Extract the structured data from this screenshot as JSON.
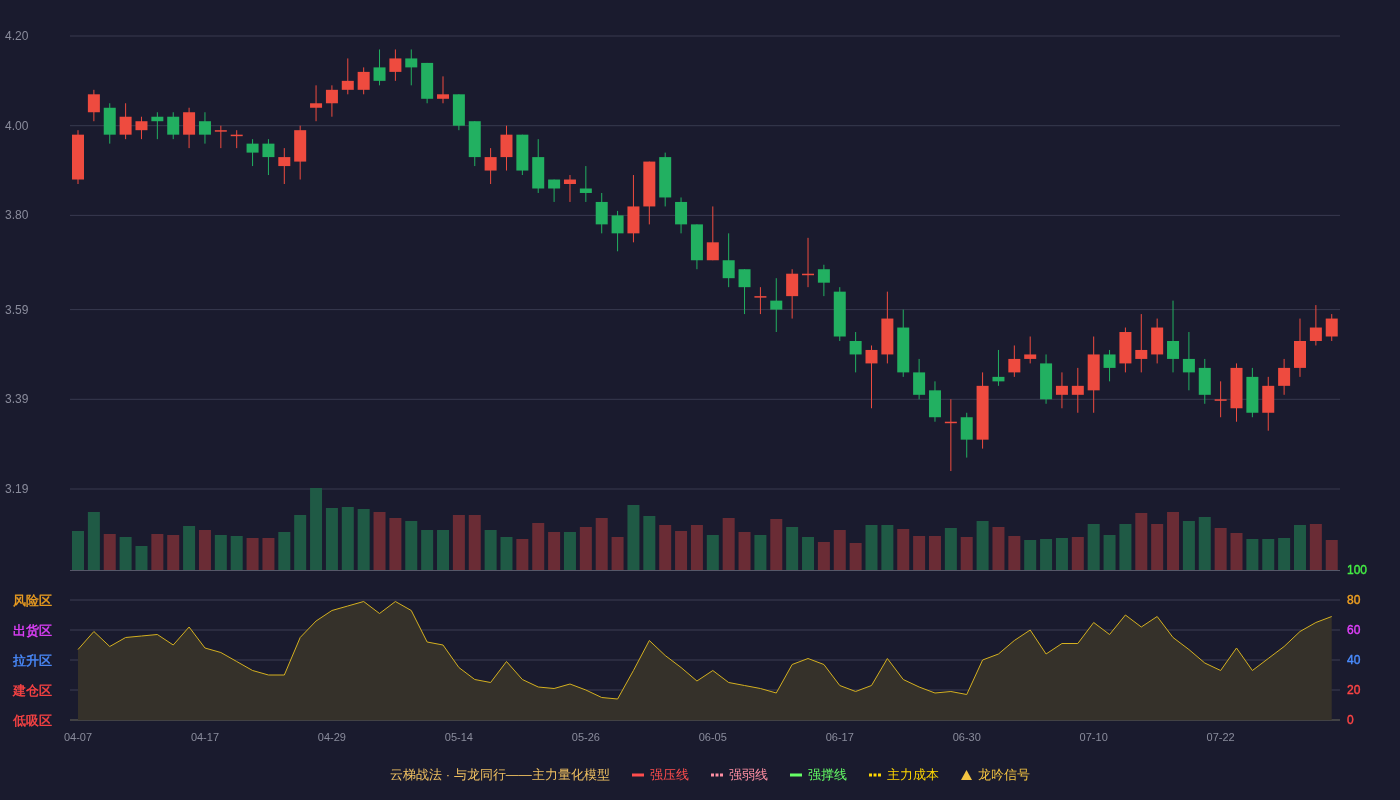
{
  "price_chart": {
    "chart_data": {
      "type": "candlestick",
      "grid": true,
      "ylim": [
        3.19,
        4.2
      ],
      "yticks": [
        {
          "value": 4.2,
          "label": "4.20"
        },
        {
          "value": 4.0,
          "label": "4.00"
        },
        {
          "value": 3.8,
          "label": "3.80"
        },
        {
          "value": 3.59,
          "label": "3.59"
        },
        {
          "value": 3.39,
          "label": "3.39"
        },
        {
          "value": 3.19,
          "label": "3.19"
        }
      ],
      "ohlc": [
        [
          3.88,
          3.99,
          3.87,
          3.98
        ],
        [
          4.03,
          4.08,
          4.01,
          4.07
        ],
        [
          4.04,
          4.05,
          3.96,
          3.98
        ],
        [
          3.98,
          4.05,
          3.97,
          4.02
        ],
        [
          3.99,
          4.02,
          3.97,
          4.01
        ],
        [
          4.02,
          4.03,
          3.97,
          4.01
        ],
        [
          4.02,
          4.03,
          3.97,
          3.98
        ],
        [
          3.98,
          4.04,
          3.95,
          4.03
        ],
        [
          4.01,
          4.03,
          3.96,
          3.98
        ],
        [
          3.99,
          4.0,
          3.95,
          3.99
        ],
        [
          3.98,
          3.99,
          3.95,
          3.98
        ],
        [
          3.96,
          3.97,
          3.91,
          3.94
        ],
        [
          3.96,
          3.97,
          3.89,
          3.93
        ],
        [
          3.91,
          3.95,
          3.87,
          3.93
        ],
        [
          3.92,
          4.0,
          3.88,
          3.99
        ],
        [
          4.04,
          4.09,
          4.01,
          4.05
        ],
        [
          4.05,
          4.09,
          4.02,
          4.08
        ],
        [
          4.08,
          4.15,
          4.07,
          4.1
        ],
        [
          4.08,
          4.13,
          4.07,
          4.12
        ],
        [
          4.13,
          4.17,
          4.09,
          4.1
        ],
        [
          4.12,
          4.17,
          4.1,
          4.15
        ],
        [
          4.15,
          4.17,
          4.09,
          4.13
        ],
        [
          4.14,
          4.14,
          4.05,
          4.06
        ],
        [
          4.06,
          4.11,
          4.05,
          4.07
        ],
        [
          4.07,
          4.07,
          3.99,
          4.0
        ],
        [
          4.01,
          4.01,
          3.91,
          3.93
        ],
        [
          3.9,
          3.95,
          3.87,
          3.93
        ],
        [
          3.93,
          4.0,
          3.9,
          3.98
        ],
        [
          3.98,
          3.98,
          3.89,
          3.9
        ],
        [
          3.93,
          3.97,
          3.85,
          3.86
        ],
        [
          3.88,
          3.88,
          3.83,
          3.86
        ],
        [
          3.87,
          3.89,
          3.83,
          3.88
        ],
        [
          3.86,
          3.91,
          3.83,
          3.85
        ],
        [
          3.83,
          3.85,
          3.76,
          3.78
        ],
        [
          3.8,
          3.81,
          3.72,
          3.76
        ],
        [
          3.76,
          3.89,
          3.74,
          3.82
        ],
        [
          3.82,
          3.92,
          3.78,
          3.92
        ],
        [
          3.93,
          3.94,
          3.82,
          3.84
        ],
        [
          3.83,
          3.84,
          3.76,
          3.78
        ],
        [
          3.78,
          3.78,
          3.68,
          3.7
        ],
        [
          3.7,
          3.82,
          3.7,
          3.74
        ],
        [
          3.7,
          3.76,
          3.64,
          3.66
        ],
        [
          3.68,
          3.68,
          3.58,
          3.64
        ],
        [
          3.62,
          3.64,
          3.58,
          3.62
        ],
        [
          3.61,
          3.66,
          3.54,
          3.59
        ],
        [
          3.62,
          3.68,
          3.57,
          3.67
        ],
        [
          3.67,
          3.75,
          3.64,
          3.67
        ],
        [
          3.68,
          3.69,
          3.62,
          3.65
        ],
        [
          3.63,
          3.64,
          3.52,
          3.53
        ],
        [
          3.52,
          3.54,
          3.45,
          3.49
        ],
        [
          3.47,
          3.51,
          3.37,
          3.5
        ],
        [
          3.49,
          3.63,
          3.47,
          3.57
        ],
        [
          3.55,
          3.59,
          3.44,
          3.45
        ],
        [
          3.45,
          3.48,
          3.39,
          3.4
        ],
        [
          3.41,
          3.43,
          3.34,
          3.35
        ],
        [
          3.34,
          3.39,
          3.23,
          3.34
        ],
        [
          3.35,
          3.36,
          3.26,
          3.3
        ],
        [
          3.3,
          3.45,
          3.28,
          3.42
        ],
        [
          3.44,
          3.5,
          3.42,
          3.43
        ],
        [
          3.45,
          3.51,
          3.44,
          3.48
        ],
        [
          3.48,
          3.53,
          3.47,
          3.49
        ],
        [
          3.47,
          3.49,
          3.38,
          3.39
        ],
        [
          3.4,
          3.45,
          3.37,
          3.42
        ],
        [
          3.4,
          3.46,
          3.36,
          3.42
        ],
        [
          3.41,
          3.53,
          3.36,
          3.49
        ],
        [
          3.49,
          3.5,
          3.43,
          3.46
        ],
        [
          3.47,
          3.55,
          3.45,
          3.54
        ],
        [
          3.48,
          3.58,
          3.45,
          3.5
        ],
        [
          3.49,
          3.57,
          3.47,
          3.55
        ],
        [
          3.52,
          3.61,
          3.45,
          3.48
        ],
        [
          3.48,
          3.54,
          3.41,
          3.45
        ],
        [
          3.46,
          3.48,
          3.38,
          3.4
        ],
        [
          3.39,
          3.43,
          3.35,
          3.39
        ],
        [
          3.37,
          3.47,
          3.34,
          3.46
        ],
        [
          3.44,
          3.46,
          3.35,
          3.36
        ],
        [
          3.36,
          3.44,
          3.32,
          3.42
        ],
        [
          3.42,
          3.48,
          3.4,
          3.46
        ],
        [
          3.46,
          3.57,
          3.44,
          3.52
        ],
        [
          3.52,
          3.6,
          3.51,
          3.55
        ],
        [
          3.53,
          3.58,
          3.52,
          3.57
        ]
      ]
    }
  },
  "indicator_chart": {
    "zones": [
      {
        "label": "风险区",
        "color": "#f0a020"
      },
      {
        "label": "出货区",
        "color": "#e040fb"
      },
      {
        "label": "拉升区",
        "color": "#4a8cff"
      },
      {
        "label": "建仓区",
        "color": "#ff4444"
      },
      {
        "label": "低吸区",
        "color": "#ff4444"
      }
    ],
    "tick_styles": [
      {
        "color": "#ff4444"
      },
      {
        "color": "#ff4444"
      },
      {
        "color": "#4a8cff"
      },
      {
        "color": "#e040fb"
      },
      {
        "color": "#f0a020"
      },
      {
        "color": "#44ee44"
      }
    ],
    "chart_data": {
      "type": "area",
      "grid": true,
      "ylim": [
        0,
        100
      ],
      "yticks": [
        0,
        20,
        40,
        60,
        80,
        100
      ],
      "categories": [
        "04-07",
        null,
        null,
        null,
        null,
        null,
        null,
        null,
        "04-17",
        null,
        null,
        null,
        null,
        null,
        null,
        null,
        "04-29",
        null,
        null,
        null,
        null,
        null,
        null,
        null,
        "05-14",
        null,
        null,
        null,
        null,
        null,
        null,
        null,
        "05-26",
        null,
        null,
        null,
        null,
        null,
        null,
        null,
        "06-05",
        null,
        null,
        null,
        null,
        null,
        null,
        null,
        "06-17",
        null,
        null,
        null,
        null,
        null,
        null,
        null,
        "06-30",
        null,
        null,
        null,
        null,
        null,
        null,
        null,
        "07-10",
        null,
        null,
        null,
        null,
        null,
        null,
        null,
        "07-22",
        null,
        null,
        null,
        null,
        null,
        null,
        null
      ],
      "series": [
        {
          "color": "#d4b020",
          "values": [
            47,
            59,
            49,
            55,
            56,
            57,
            50,
            62,
            48,
            45,
            39,
            33,
            30,
            30,
            55,
            66,
            73,
            76,
            79,
            71,
            79,
            73,
            52,
            50,
            35,
            27,
            25,
            39,
            27,
            22,
            21,
            24,
            20,
            15,
            14,
            33,
            53,
            43,
            35,
            26,
            33,
            25,
            23,
            21,
            18,
            37,
            41,
            37,
            23,
            19,
            23,
            41,
            27,
            22,
            18,
            19,
            17,
            40,
            44,
            53,
            60,
            44,
            51,
            51,
            65,
            57,
            70,
            62,
            69,
            55,
            47,
            38,
            33,
            48,
            33,
            41,
            49,
            59,
            65,
            69
          ]
        }
      ]
    }
  },
  "legend": {
    "title": "云梯战法 · 与龙同行——主力量化模型",
    "items": [
      {
        "kind": "solid",
        "label": "强压线",
        "color": "#ff4d4d"
      },
      {
        "kind": "dashed",
        "label": "强弱线",
        "color": "#ff8fa3"
      },
      {
        "kind": "solid",
        "label": "强撑线",
        "color": "#66ff66"
      },
      {
        "kind": "dashed",
        "label": "主力成本",
        "color": "#ffd700"
      },
      {
        "kind": "triangle",
        "label": "龙吟信号",
        "color": "#f5c542"
      }
    ]
  }
}
